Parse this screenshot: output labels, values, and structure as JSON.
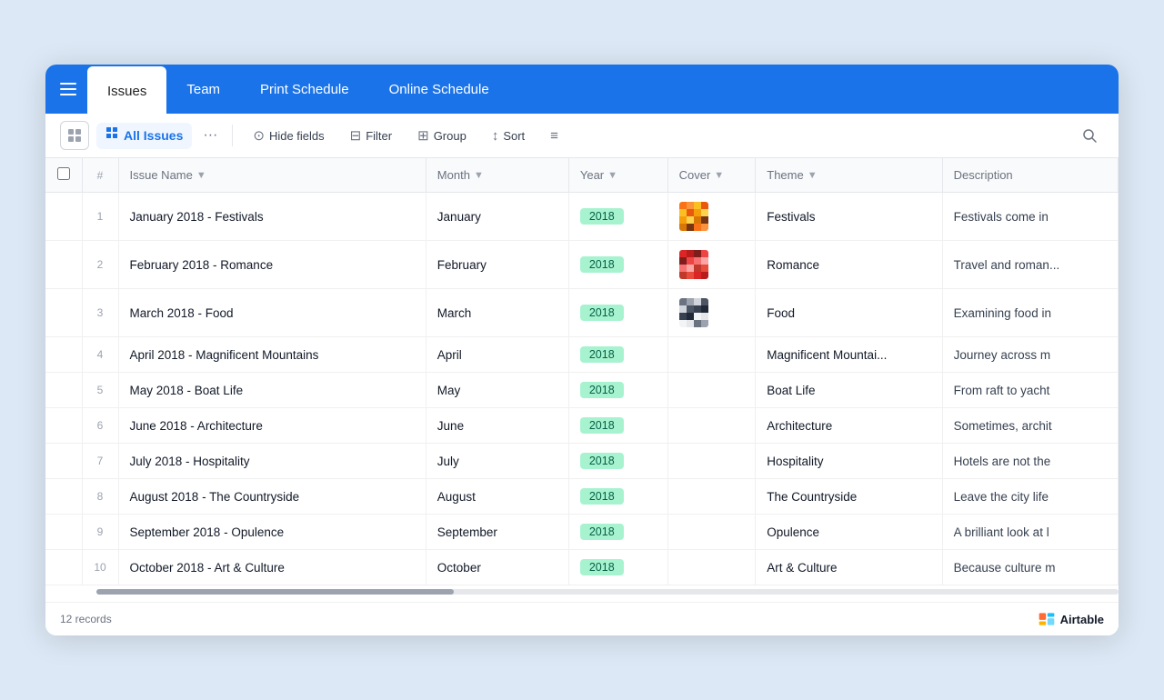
{
  "nav": {
    "tabs": [
      {
        "id": "issues",
        "label": "Issues",
        "active": true
      },
      {
        "id": "team",
        "label": "Team",
        "active": false
      },
      {
        "id": "print-schedule",
        "label": "Print Schedule",
        "active": false
      },
      {
        "id": "online-schedule",
        "label": "Online Schedule",
        "active": false
      }
    ]
  },
  "toolbar": {
    "views_label": "All Issues",
    "hide_fields": "Hide fields",
    "filter": "Filter",
    "group": "Group",
    "sort": "Sort",
    "dots": "···"
  },
  "table": {
    "columns": [
      {
        "id": "checkbox",
        "label": ""
      },
      {
        "id": "num",
        "label": "#"
      },
      {
        "id": "issue_name",
        "label": "Issue Name"
      },
      {
        "id": "month",
        "label": "Month"
      },
      {
        "id": "year",
        "label": "Year"
      },
      {
        "id": "cover",
        "label": "Cover"
      },
      {
        "id": "theme",
        "label": "Theme"
      },
      {
        "id": "description",
        "label": "Description"
      }
    ],
    "rows": [
      {
        "num": 1,
        "issue_name": "January 2018 - Festivals",
        "month": "January",
        "year": "2018",
        "has_cover": true,
        "cover_type": "orange",
        "theme": "Festivals",
        "description": "Festivals come in"
      },
      {
        "num": 2,
        "issue_name": "February 2018 - Romance",
        "month": "February",
        "year": "2018",
        "has_cover": true,
        "cover_type": "red",
        "theme": "Romance",
        "description": "Travel and roman..."
      },
      {
        "num": 3,
        "issue_name": "March 2018 - Food",
        "month": "March",
        "year": "2018",
        "has_cover": true,
        "cover_type": "gray",
        "theme": "Food",
        "description": "Examining food in"
      },
      {
        "num": 4,
        "issue_name": "April 2018 - Magnificent Mountains",
        "month": "April",
        "year": "2018",
        "has_cover": false,
        "cover_type": "",
        "theme": "Magnificent Mountai...",
        "description": "Journey across m"
      },
      {
        "num": 5,
        "issue_name": "May 2018 - Boat Life",
        "month": "May",
        "year": "2018",
        "has_cover": false,
        "cover_type": "",
        "theme": "Boat Life",
        "description": "From raft to yacht"
      },
      {
        "num": 6,
        "issue_name": "June 2018 - Architecture",
        "month": "June",
        "year": "2018",
        "has_cover": false,
        "cover_type": "",
        "theme": "Architecture",
        "description": "Sometimes, archit"
      },
      {
        "num": 7,
        "issue_name": "July 2018 - Hospitality",
        "month": "July",
        "year": "2018",
        "has_cover": false,
        "cover_type": "",
        "theme": "Hospitality",
        "description": "Hotels are not the"
      },
      {
        "num": 8,
        "issue_name": "August 2018 - The Countryside",
        "month": "August",
        "year": "2018",
        "has_cover": false,
        "cover_type": "",
        "theme": "The Countryside",
        "description": "Leave the city life"
      },
      {
        "num": 9,
        "issue_name": "September 2018 - Opulence",
        "month": "September",
        "year": "2018",
        "has_cover": false,
        "cover_type": "",
        "theme": "Opulence",
        "description": "A brilliant look at l"
      },
      {
        "num": 10,
        "issue_name": "October 2018 - Art & Culture",
        "month": "October",
        "year": "2018",
        "has_cover": false,
        "cover_type": "",
        "theme": "Art & Culture",
        "description": "Because culture m"
      }
    ],
    "total_records": "12 records"
  },
  "footer": {
    "logo_text": "Airtable"
  }
}
